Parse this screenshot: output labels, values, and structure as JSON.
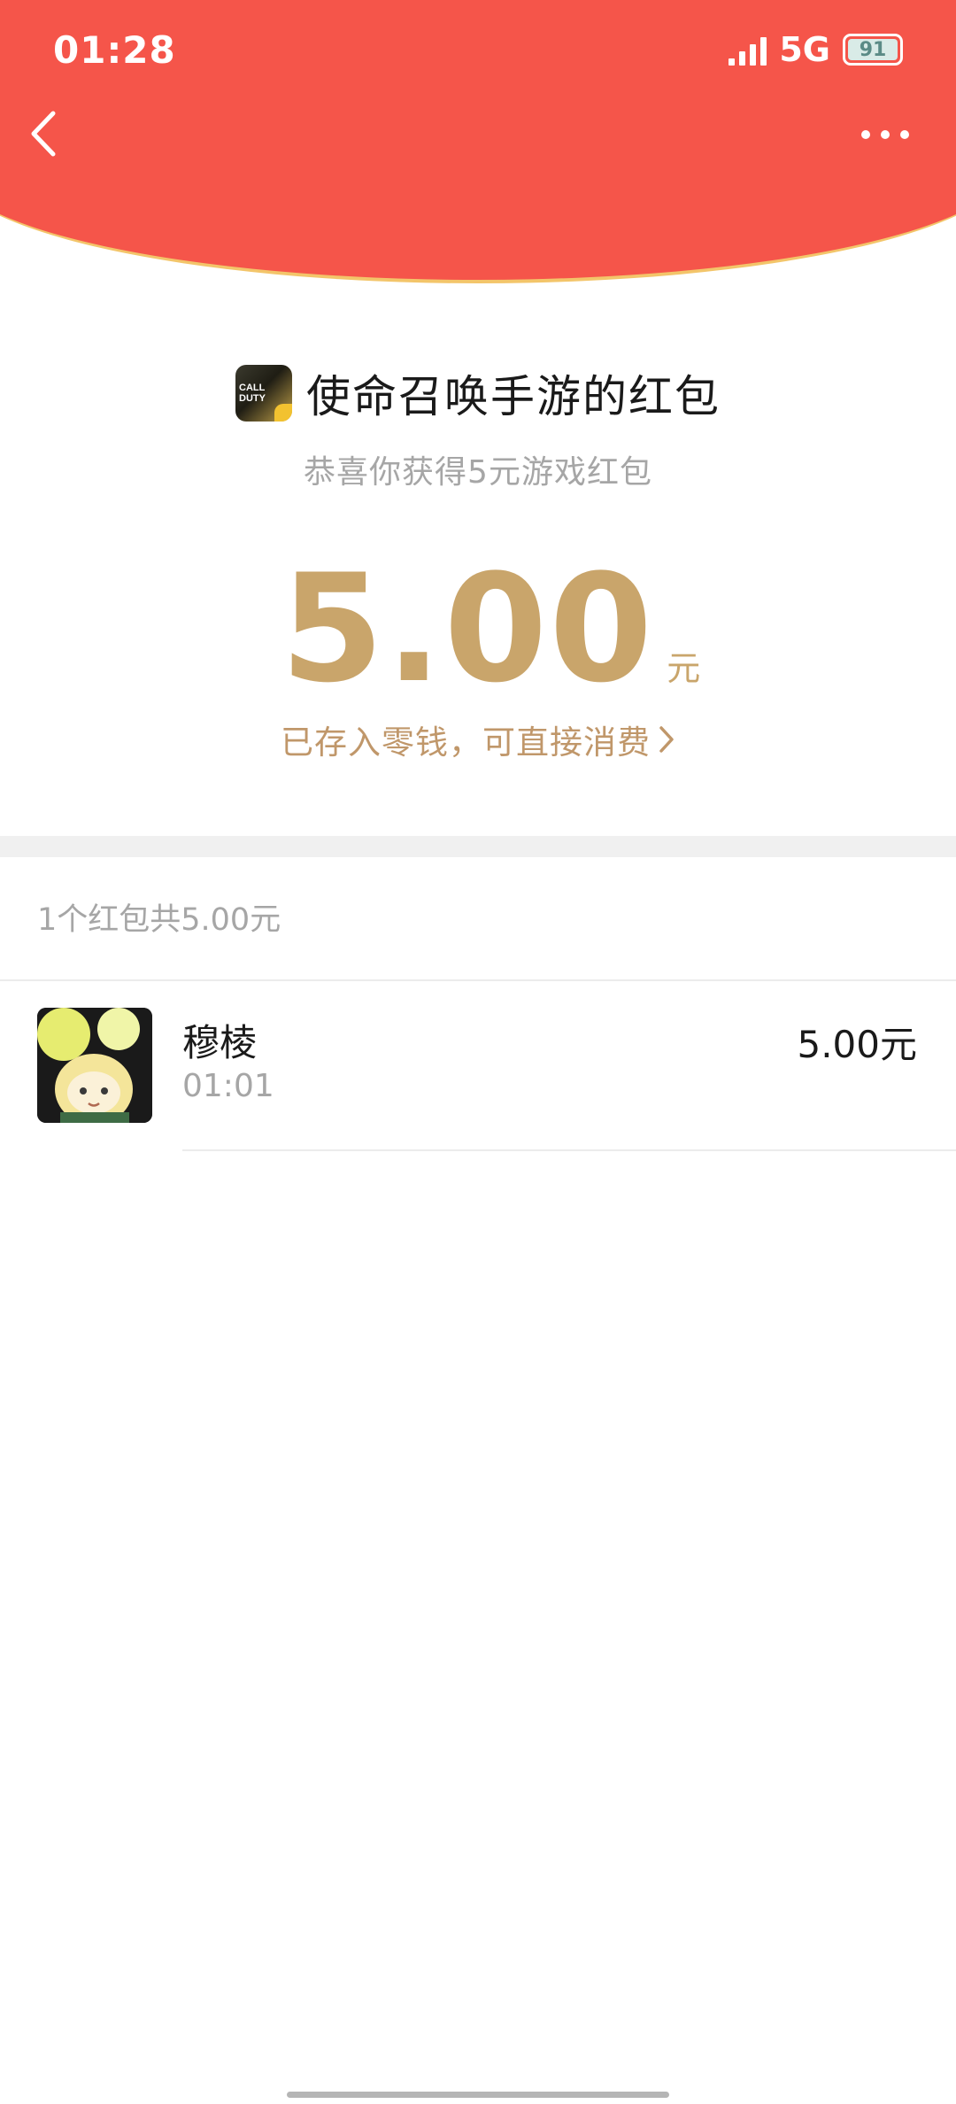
{
  "status_bar": {
    "time": "01:28",
    "network": "5G",
    "battery": "91"
  },
  "header": {
    "back_icon": "chevron-left-icon",
    "more_icon": "more-dots-icon",
    "bg_color": "#f5554a"
  },
  "packet": {
    "title": "使命召唤手游的红包",
    "subtitle": "恭喜你获得5元游戏红包",
    "amount": "5.00",
    "unit": "元",
    "wallet_link": "已存入零钱，可直接消费",
    "accent_color": "#c9a56b"
  },
  "summary": "1个红包共5.00元",
  "records": [
    {
      "name": "穆棱",
      "time": "01:01",
      "amount": "5.00元"
    }
  ]
}
